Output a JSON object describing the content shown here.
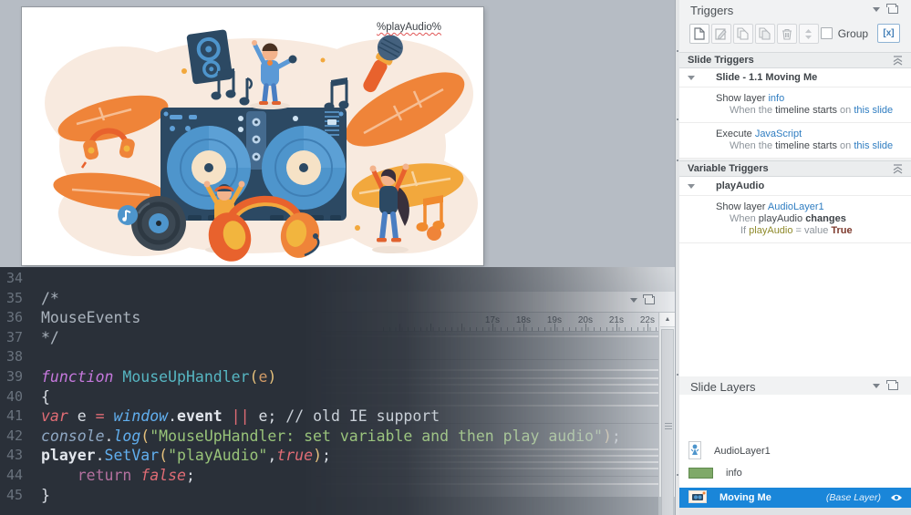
{
  "canvas": {
    "variable_text": "%playAudio%"
  },
  "code_editor": {
    "lines": [
      {
        "n": "34",
        "tokens": []
      },
      {
        "n": "35",
        "tokens": [
          {
            "t": "/*",
            "c": "cm"
          }
        ]
      },
      {
        "n": "36",
        "tokens": [
          {
            "t": "MouseEvents",
            "c": "cm"
          }
        ]
      },
      {
        "n": "37",
        "tokens": [
          {
            "t": "*/",
            "c": "cm"
          }
        ]
      },
      {
        "n": "38",
        "tokens": []
      },
      {
        "n": "39",
        "tokens": [
          {
            "t": "function",
            "c": "kw"
          },
          {
            "t": " ",
            "c": "pl"
          },
          {
            "t": "MouseUpHandler",
            "c": "fn"
          },
          {
            "t": "(",
            "c": "pa"
          },
          {
            "t": "e",
            "c": "ar"
          },
          {
            "t": ")",
            "c": "pa"
          }
        ]
      },
      {
        "n": "40",
        "tokens": [
          {
            "t": "{",
            "c": "pl"
          }
        ]
      },
      {
        "n": "41",
        "tokens": [
          {
            "t": "var",
            "c": "kwi"
          },
          {
            "t": " e ",
            "c": "pl"
          },
          {
            "t": "=",
            "c": "op"
          },
          {
            "t": " ",
            "c": "pl"
          },
          {
            "t": "window",
            "c": "obj"
          },
          {
            "t": ".",
            "c": "pl"
          },
          {
            "t": "event",
            "c": "prop"
          },
          {
            "t": " ",
            "c": "pl"
          },
          {
            "t": "||",
            "c": "op"
          },
          {
            "t": " e; ",
            "c": "pl"
          },
          {
            "t": "// old IE support",
            "c": "cm2"
          }
        ]
      },
      {
        "n": "42",
        "tokens": [
          {
            "t": "console",
            "c": "obj2"
          },
          {
            "t": ".",
            "c": "pl"
          },
          {
            "t": "log",
            "c": "fn2"
          },
          {
            "t": "(",
            "c": "pa"
          },
          {
            "t": "\"MouseUpHandler: set variable and then play audio\"",
            "c": "str"
          },
          {
            "t": ")",
            "c": "pa"
          },
          {
            "t": ";",
            "c": "pl"
          }
        ]
      },
      {
        "n": "43",
        "tokens": [
          {
            "t": "player",
            "c": "prop"
          },
          {
            "t": ".",
            "c": "pl"
          },
          {
            "t": "SetVar",
            "c": "fn3"
          },
          {
            "t": "(",
            "c": "pa"
          },
          {
            "t": "\"playAudio\"",
            "c": "str"
          },
          {
            "t": ",",
            "c": "pl"
          },
          {
            "t": "true",
            "c": "bool"
          },
          {
            "t": ")",
            "c": "pa"
          },
          {
            "t": ";",
            "c": "pl"
          }
        ]
      },
      {
        "n": "44",
        "tokens": [
          {
            "t": "    ",
            "c": "pl"
          },
          {
            "t": "return",
            "c": "ret"
          },
          {
            "t": " ",
            "c": "pl"
          },
          {
            "t": "false",
            "c": "bool"
          },
          {
            "t": ";",
            "c": "pl"
          }
        ]
      },
      {
        "n": "45",
        "tokens": [
          {
            "t": "}",
            "c": "pl"
          }
        ]
      }
    ]
  },
  "timeline": {
    "ruler_labels": [
      "17s",
      "18s",
      "19s",
      "20s",
      "21s",
      "22s"
    ],
    "icons": [
      "chevron-down-icon",
      "float-panel-icon",
      "scroll-up-icon"
    ]
  },
  "triggers_panel": {
    "title": "Triggers",
    "toolbar": {
      "group_label": "Group",
      "variables_button_glyph": "[x]",
      "icons": [
        "new-trigger-icon",
        "edit-trigger-icon",
        "copy-trigger-icon",
        "paste-trigger-icon",
        "delete-trigger-icon",
        "reorder-trigger-icon",
        "manage-variables-icon"
      ]
    },
    "slide_triggers": {
      "header": "Slide Triggers",
      "group": "Slide - 1.1 Moving Me",
      "items": [
        {
          "title": [
            {
              "t": "Show layer ",
              "s": "dark"
            },
            {
              "t": "info",
              "s": "link"
            }
          ],
          "desc": [
            {
              "t": "When the ",
              "s": "mute"
            },
            {
              "t": "timeline starts",
              "s": "dark"
            },
            {
              "t": " on ",
              "s": "mute"
            },
            {
              "t": "this slide",
              "s": "link"
            }
          ]
        },
        {
          "title": [
            {
              "t": "Execute ",
              "s": "dark"
            },
            {
              "t": "JavaScript",
              "s": "link"
            }
          ],
          "desc": [
            {
              "t": "When the ",
              "s": "mute"
            },
            {
              "t": "timeline starts",
              "s": "dark"
            },
            {
              "t": " on ",
              "s": "mute"
            },
            {
              "t": "this slide",
              "s": "link"
            }
          ]
        }
      ]
    },
    "variable_triggers": {
      "header": "Variable Triggers",
      "group": "playAudio",
      "items": [
        {
          "title": [
            {
              "t": "Show layer ",
              "s": "dark"
            },
            {
              "t": "AudioLayer1",
              "s": "link"
            }
          ],
          "desc": [
            {
              "t": "When ",
              "s": "mute"
            },
            {
              "t": "playAudio",
              "s": "dark"
            },
            {
              "t": " ",
              "s": "mute"
            },
            {
              "t": "changes",
              "s": "bold"
            }
          ],
          "cond": [
            {
              "t": "If ",
              "s": "mute"
            },
            {
              "t": "playAudio",
              "s": "var"
            },
            {
              "t": " = value ",
              "s": "mute"
            },
            {
              "t": "True",
              "s": "val"
            }
          ]
        }
      ]
    }
  },
  "slide_layers_panel": {
    "title": "Slide Layers",
    "layers": [
      {
        "name": "AudioLayer1",
        "thumb": "person",
        "selected": false
      },
      {
        "name": "info",
        "thumb": "green-rect",
        "selected": false
      },
      {
        "name": "Moving Me",
        "thumb": "scene",
        "selected": true,
        "badge": "(Base Layer)",
        "eye": true
      }
    ],
    "colors": {
      "selection": "#1a86d9"
    }
  },
  "colors": {
    "stage_background": "#b6bcc4",
    "code_background": "#2a3039",
    "panel_background": "#f1f2f3",
    "link_blue": "#2f7dc1"
  }
}
